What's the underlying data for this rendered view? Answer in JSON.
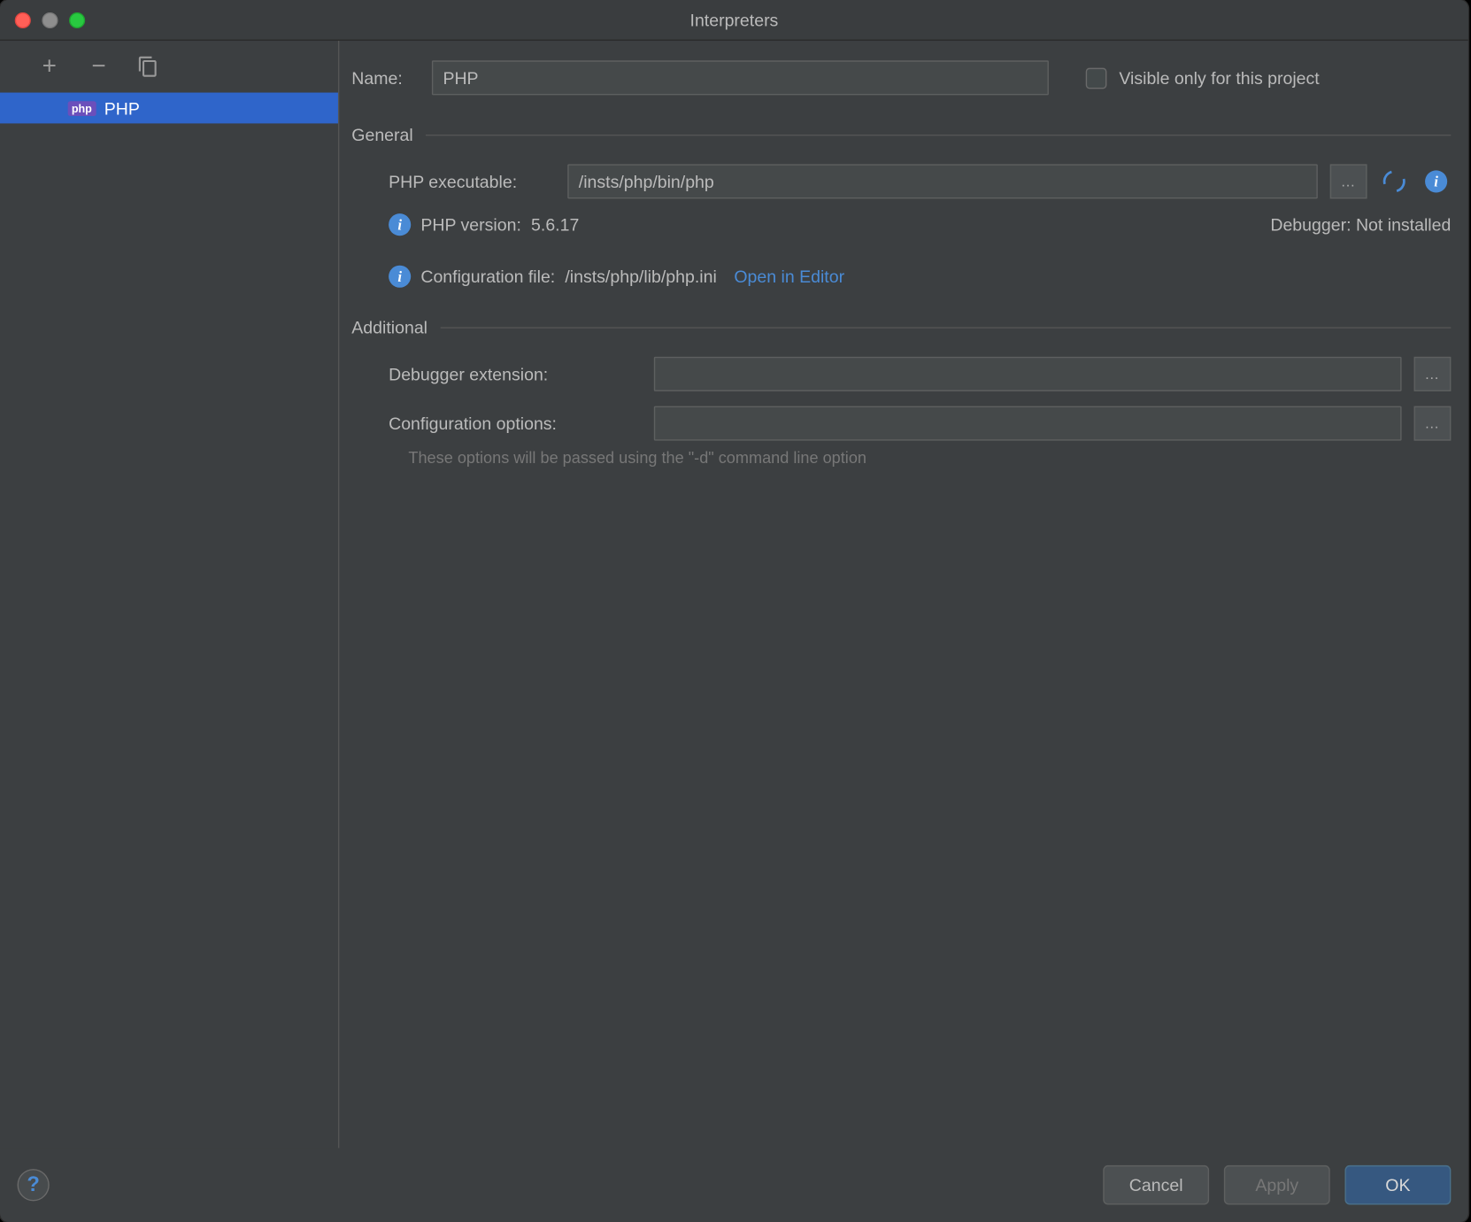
{
  "window": {
    "title": "Interpreters"
  },
  "sidebar": {
    "items": [
      "PHP"
    ]
  },
  "form": {
    "name_label": "Name:",
    "name_value": "PHP",
    "visible_label": "Visible only for this project",
    "section_general": "General",
    "php_exec_label": "PHP executable:",
    "php_exec_value": "/insts/php/bin/php",
    "php_version_label": "PHP version:",
    "php_version_value": "5.6.17",
    "debugger_label": "Debugger:",
    "debugger_value": "Not installed",
    "config_file_label": "Configuration file:",
    "config_file_value": "/insts/php/lib/php.ini",
    "open_editor": "Open in Editor",
    "section_additional": "Additional",
    "debugger_ext_label": "Debugger extension:",
    "debugger_ext_value": "",
    "config_opts_label": "Configuration options:",
    "config_opts_value": "",
    "hint": "These options will be passed using the \"-d\" command line option"
  },
  "footer": {
    "cancel": "Cancel",
    "apply": "Apply",
    "ok": "OK"
  }
}
